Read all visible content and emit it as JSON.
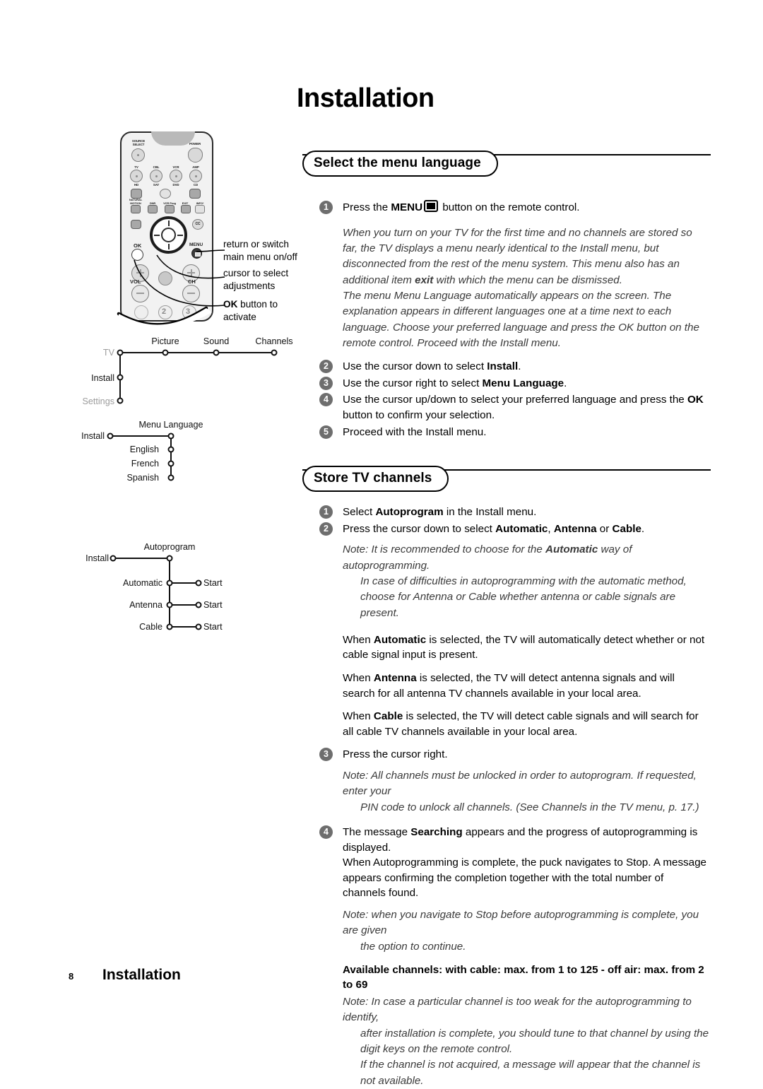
{
  "page": {
    "title": "Installation",
    "footer_page_number": "8",
    "footer_title": "Installation"
  },
  "sections": [
    {
      "id": "select-menu-language",
      "heading": "Select the menu language",
      "steps": [
        {
          "num": "1",
          "text_before": "Press the ",
          "bold": "MENU",
          "icon": "menu-screen-icon",
          "text_after": " button on the remote control."
        },
        {
          "num": "2",
          "html": "Use the cursor down to select <b>Install</b>."
        },
        {
          "num": "3",
          "html": "Use the cursor right to select <b>Menu Language</b>."
        },
        {
          "num": "4",
          "html": "Use the cursor up/down to select your preferred language and press the <b>OK</b> button to confirm your selection."
        },
        {
          "num": "5",
          "html": "Proceed with the Install menu."
        }
      ],
      "notes": [
        "When you turn on your TV for the first time and no channels are stored so far, the TV displays a menu nearly identical to the Install menu, but disconnected from the rest of the menu system. This menu also has an additional item <b>exit</b> with which the menu can be dismissed.",
        "The menu Menu Language automatically appears on the screen. The explanation appears in different languages one at a time next to each language. Choose your preferred language and press the OK button on the remote control. Proceed with the Install menu."
      ]
    },
    {
      "id": "store-tv-channels",
      "heading": "Store TV channels",
      "steps": [
        {
          "num": "1",
          "html": "Select <b>Autoprogram</b> in the Install menu."
        },
        {
          "num": "2",
          "html": "Press the cursor down to select <b>Automatic</b>, <b>Antenna</b> or <b>Cable</b>."
        },
        {
          "num": "3",
          "html": "Press the cursor right."
        },
        {
          "num": "4",
          "html": "The message <b>Searching</b> appears and the progress of autoprogramming is displayed.<br>When Autoprogramming is complete, the puck navigates to Stop. A message appears confirming the completion together with the total number of channels found."
        }
      ],
      "note_after_2_a": "Note: It is recommended to choose for the <b>Automatic</b> way of autoprogramming.",
      "note_after_2_b": "In case of difficulties in autoprogramming with the automatic method, choose for Antenna or Cable whether antenna or cable signals are present.",
      "para_automatic": "When <b>Automatic</b> is selected, the TV will automatically detect whether or not cable signal input is present.",
      "para_antenna": "When <b>Antenna</b> is selected, the TV will detect antenna signals and will search for all antenna TV channels available in your local area.",
      "para_cable": "When <b>Cable</b> is selected, the TV will detect cable signals and will search for all cable TV channels available in your local area.",
      "note_after_3_a": "Note: All channels must be unlocked in order to autoprogram. If requested, enter your",
      "note_after_3_b": "PIN code to unlock all channels. (See Channels in the TV menu, p. 17.)",
      "note_after_4_a": "Note: when you navigate to Stop before autoprogramming is complete, you are given",
      "note_after_4_b": "the option to continue.",
      "available_channels": "Available channels:  with cable: max. from 1 to 125  -  off air: max. from 2 to 69",
      "note_final_a": "Note: In case a particular channel is too weak for the autoprogramming to identify,",
      "note_final_b": "after installation is complete, you should tune to that channel by using the digit keys on the remote control.",
      "note_final_c": "If the channel is not acquired, a message will appear that the channel is not available."
    }
  ],
  "remote": {
    "labels": {
      "source_select": "SOURCE SELECT",
      "power": "POWER",
      "tv": "TV",
      "cbl": "CBL",
      "vcr": "VCR",
      "amp": "AMP",
      "hd": "HD",
      "sat": "SAT",
      "dvd": "DVD",
      "cd": "CD",
      "natural_motion": "NATURAL MOTION",
      "dnr": "DNR",
      "vcr_prog": "VCR Prog",
      "exit": "EXIT",
      "info": "INFO*",
      "cc": "CC",
      "ok": "OK",
      "menu": "MENU",
      "vol": "VOL",
      "ch": "CH",
      "key2": "2",
      "key3": "3"
    }
  },
  "callouts": [
    {
      "line1": "return or switch",
      "line2": "main menu on/off"
    },
    {
      "line1": "cursor to select",
      "line2": "adjustments"
    },
    {
      "line1_bold": "OK",
      "line1_rest": " button to",
      "line2": "activate"
    }
  ],
  "trees": {
    "tv_tree": {
      "left_labels": [
        {
          "text": "TV",
          "grey": true
        },
        {
          "text": "Install",
          "grey": false
        },
        {
          "text": "Settings",
          "grey": true
        }
      ],
      "top_labels": [
        "Picture",
        "Sound",
        "Channels"
      ]
    },
    "language_tree": {
      "root": "Install",
      "branch": "Menu Language",
      "children": [
        "English",
        "French",
        "Spanish"
      ]
    },
    "autoprogram_tree": {
      "root": "Install",
      "branch": "Autoprogram",
      "children": [
        "Automatic",
        "Antenna",
        "Cable"
      ],
      "leaf_label": "Start",
      "leaves": [
        "Start",
        "Start",
        "Start"
      ]
    }
  },
  "colors": {
    "step_badge": "#6e6e6e",
    "italic_note": "#3a3a3a",
    "grey_label": "#9c9c9c",
    "ink": "#000000"
  }
}
